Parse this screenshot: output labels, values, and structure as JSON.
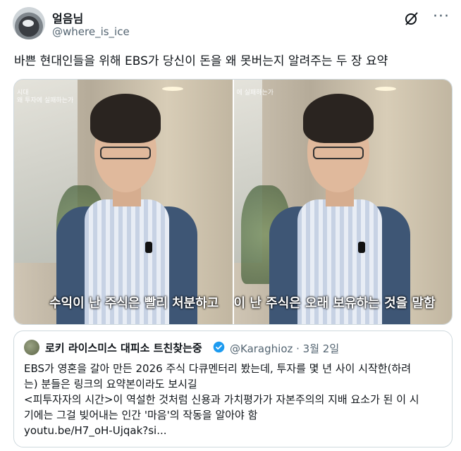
{
  "post": {
    "author_name": "얼음님",
    "author_handle": "@where_is_ice",
    "more_label": "···",
    "text": "바쁜 현대인들을 위해 EBS가 당신이 돈을 왜 못버는지 알려주는 두 장 요약"
  },
  "media": [
    {
      "overlay_title": "시대",
      "overlay_caption": "왜 투자에 실패하는가",
      "subtitle": "수익이 난 주식은 빨리 처분하고"
    },
    {
      "overlay_title": "",
      "overlay_caption": "에 실패하는가",
      "subtitle": "이 난 주식은 오래 보유하는 것을 말함"
    }
  ],
  "quote": {
    "author_name": "로키 라이스미스 대피소 트친찾는중",
    "author_handle": "@Karaghioz · 3월 2일",
    "lines": [
      "EBS가 영혼을 갈아 만든 2026 주식 다큐멘터리 봤는데, 투자를 몇 년 사이 시작한(하려",
      "는) 분들은 링크의 요약본이라도 보시길",
      "<피투자자의 시간>이 역설한 것처럼 신용과 가치평가가 자본주의의 지배 요소가 된 이 시",
      "기에는 그걸 빚어내는 인간 '마음'의 작동을 알아야 함",
      "youtu.be/H7_oH-Ujqak?si..."
    ]
  },
  "colors": {
    "text": "#0f1419",
    "secondary": "#536471",
    "verified": "#1d9bf0",
    "border": "#cfd9de"
  },
  "icons": {
    "grok": "grok-icon",
    "verified": "verified-badge-icon"
  }
}
